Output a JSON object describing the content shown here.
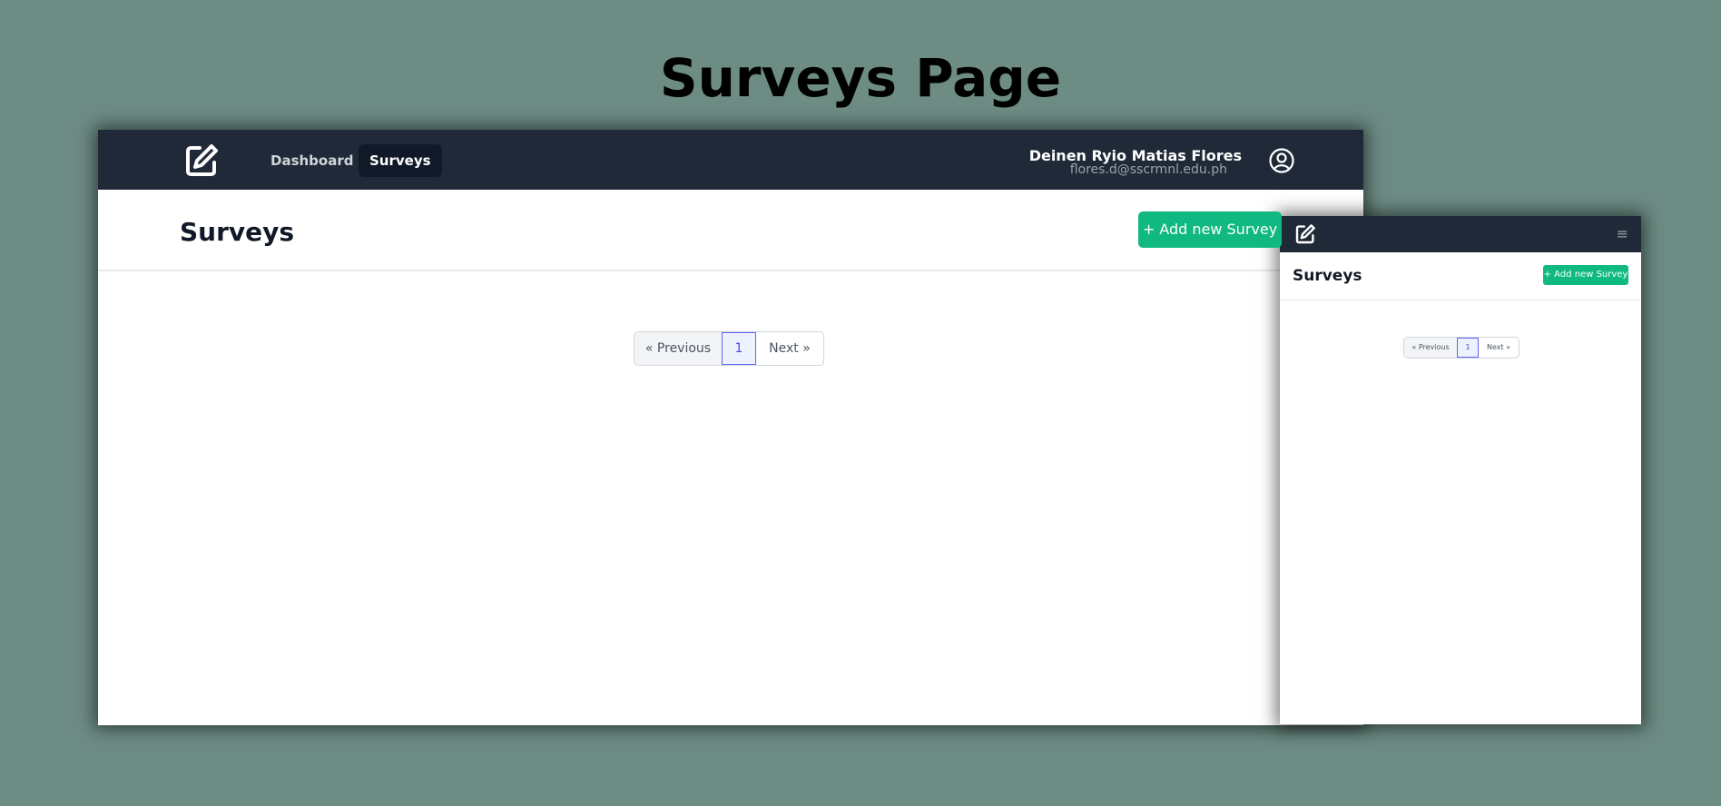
{
  "headline": "Surveys Page",
  "desktop": {
    "nav": {
      "links": [
        {
          "label": "Dashboard",
          "active": false
        },
        {
          "label": "Surveys",
          "active": true
        }
      ],
      "user": {
        "name": "Deinen Ryio Matias Flores",
        "email": "flores.d@sscrmnl.edu.ph"
      }
    },
    "page_title": "Surveys",
    "add_button": "+ Add new Survey",
    "pagination": {
      "prev": "« Previous",
      "current": "1",
      "next": "Next »"
    }
  },
  "mobile": {
    "menu_icon": "≡",
    "page_title": "Surveys",
    "add_button": "+ Add new Survey",
    "pagination": {
      "prev": "« Previous",
      "current": "1",
      "next": "Next »"
    }
  },
  "colors": {
    "background": "#6d8c84",
    "nav": "#1f2937",
    "accent": "#10b981",
    "pager_current": "#4f46e5"
  },
  "icons": {
    "logo": "pencil-square-icon",
    "user": "user-circle-icon",
    "menu": "hamburger-menu-icon"
  }
}
